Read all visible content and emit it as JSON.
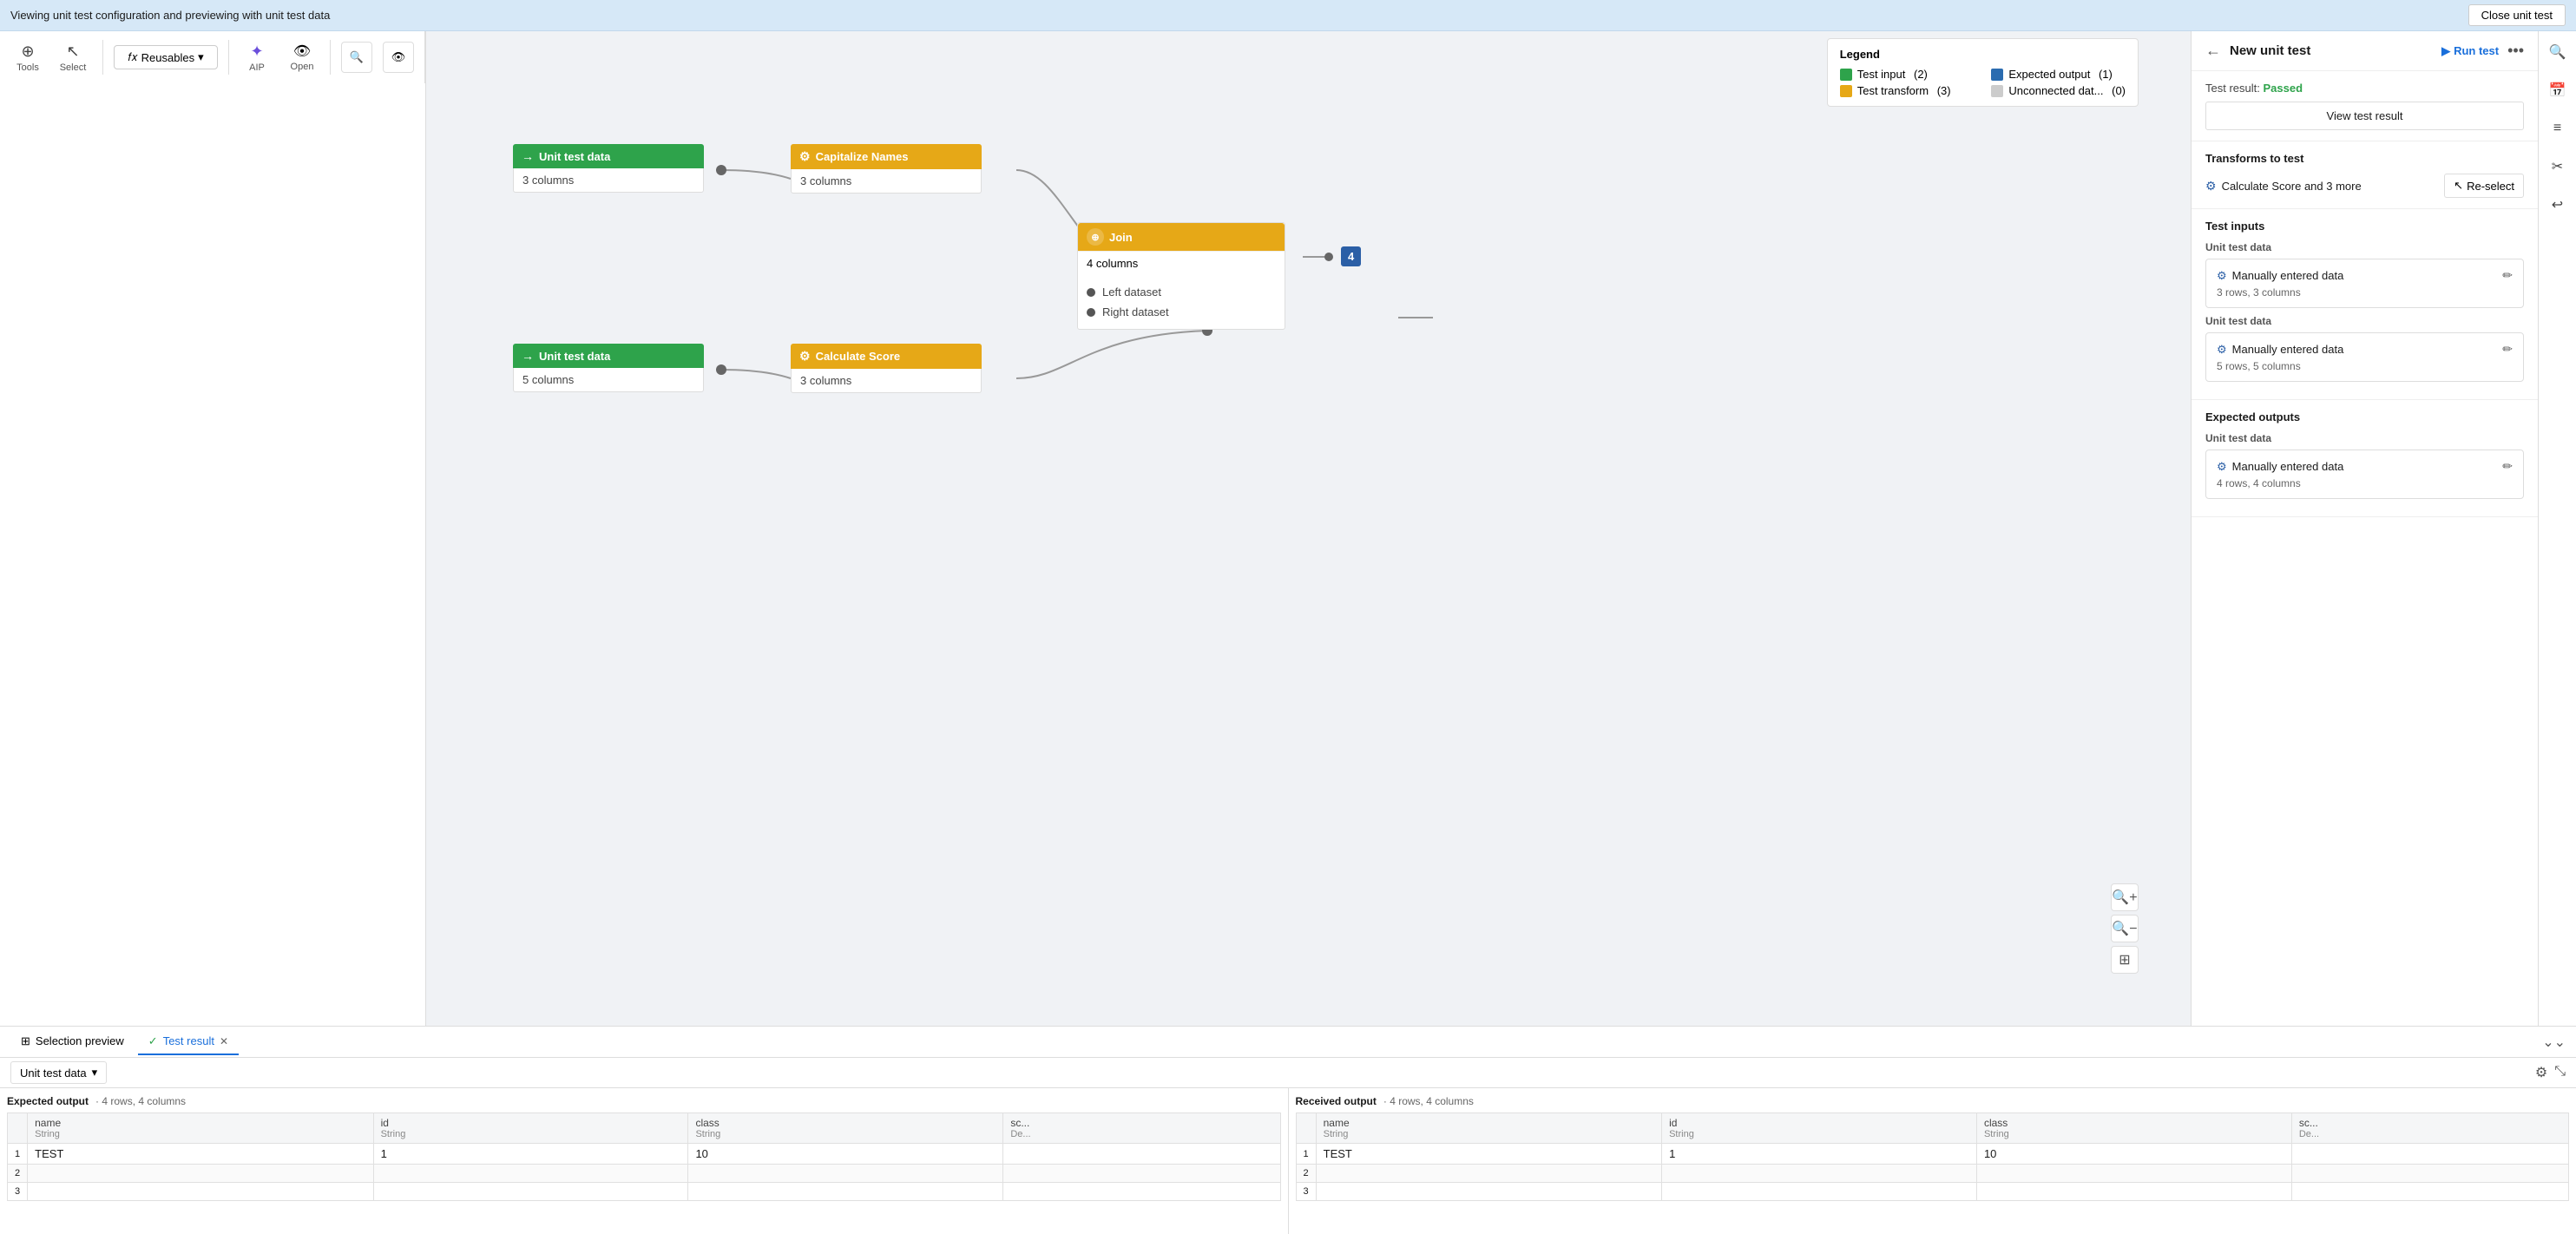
{
  "topBar": {
    "text": "Viewing unit test configuration and previewing with unit test data",
    "closeBtn": "Close unit test"
  },
  "toolbar": {
    "tools": "Tools",
    "select": "Select",
    "reusables": "Reusables",
    "aip": "AIP",
    "open": "Open"
  },
  "legend": {
    "title": "Legend",
    "items": [
      {
        "label": "Test input",
        "count": "(2)",
        "color": "green"
      },
      {
        "label": "Expected output",
        "count": "(1)",
        "color": "blue"
      },
      {
        "label": "Test transform",
        "count": "(3)",
        "color": "orange"
      },
      {
        "label": "Unconnected dat...",
        "count": "(0)",
        "color": "gray"
      }
    ]
  },
  "nodes": [
    {
      "id": "unit-test-data-1",
      "type": "green",
      "title": "Unit test data",
      "meta": "3 columns",
      "icon": "→"
    },
    {
      "id": "capitalize-names",
      "type": "orange",
      "title": "Capitalize Names",
      "meta": "3 columns",
      "icon": "⚙"
    },
    {
      "id": "unit-test-data-2",
      "type": "green",
      "title": "Unit test data",
      "meta": "5 columns",
      "icon": "→"
    },
    {
      "id": "calculate-score",
      "type": "orange",
      "title": "Calculate Score",
      "meta": "3 columns",
      "icon": "⚙"
    },
    {
      "id": "join",
      "type": "orange",
      "title": "Join",
      "meta": "4 columns",
      "icon": "⊕",
      "ports": [
        "Left dataset",
        "Right dataset"
      ]
    }
  ],
  "rightPanel": {
    "backBtn": "←",
    "title": "New unit test",
    "runTestBtn": "Run test",
    "moreBtn": "•••",
    "testResult": {
      "label": "Test result:",
      "status": "Passed",
      "viewBtn": "View test result"
    },
    "transformsSection": {
      "title": "Transforms to test",
      "name": "Calculate Score and 3 more",
      "reselectBtn": "Re-select"
    },
    "testInputs": {
      "title": "Test inputs",
      "items": [
        {
          "label": "Unit test data",
          "name": "Manually entered data",
          "meta": "3 rows, 3 columns"
        },
        {
          "label": "Unit test data",
          "name": "Manually entered data",
          "meta": "5 rows, 5 columns"
        }
      ]
    },
    "expectedOutputs": {
      "title": "Expected outputs",
      "items": [
        {
          "label": "Unit test data",
          "name": "Manually entered data",
          "meta": "4 rows, 4 columns"
        }
      ]
    }
  },
  "bottomPanel": {
    "tabs": [
      {
        "label": "Selection preview",
        "active": false,
        "icon": "⊞",
        "closeable": false
      },
      {
        "label": "Test result",
        "active": true,
        "icon": "✓",
        "closeable": true
      }
    ],
    "dropdown": "Unit test data",
    "expectedOutput": {
      "title": "Expected output",
      "meta": "· 4 rows, 4 columns",
      "columns": [
        {
          "name": "name",
          "type": "String"
        },
        {
          "name": "id",
          "type": "String"
        },
        {
          "name": "class",
          "type": "String"
        },
        {
          "name": "sc...",
          "type": "De..."
        }
      ],
      "rows": [
        [
          "TEST",
          "1",
          "10",
          ""
        ],
        [
          "",
          "",
          "",
          ""
        ],
        [
          "",
          "",
          "",
          ""
        ]
      ]
    },
    "receivedOutput": {
      "title": "Received output",
      "meta": "· 4 rows, 4 columns",
      "columns": [
        {
          "name": "name",
          "type": "String"
        },
        {
          "name": "id",
          "type": "String"
        },
        {
          "name": "class",
          "type": "String"
        },
        {
          "name": "sc...",
          "type": "De..."
        }
      ],
      "rows": [
        [
          "TEST",
          "1",
          "10",
          ""
        ],
        [
          "",
          "",
          "",
          ""
        ],
        [
          "",
          "",
          "",
          ""
        ]
      ]
    }
  },
  "farRight": {
    "icons": [
      "⚲",
      "📅",
      "≡",
      "✂",
      "↩"
    ]
  }
}
